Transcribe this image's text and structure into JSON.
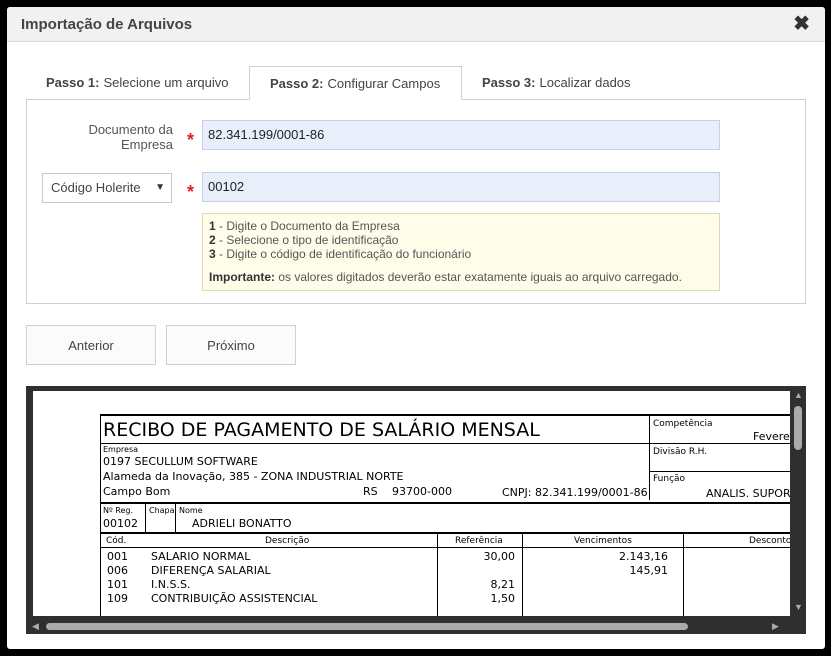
{
  "dialog": {
    "title": "Importação de Arquivos",
    "close_glyph": "✖"
  },
  "tabs": [
    {
      "step": "Passo 1:",
      "label": "Selecione um arquivo"
    },
    {
      "step": "Passo 2:",
      "label": "Configurar Campos"
    },
    {
      "step": "Passo 3:",
      "label": "Localizar dados"
    }
  ],
  "form": {
    "doc_label_line1": "Documento da",
    "doc_label_line2": "Empresa",
    "doc_value": "82.341.199/0001-86",
    "id_type_selected": "Código Holerite",
    "id_value": "00102",
    "required_mark": "*"
  },
  "hint": {
    "n1": "1",
    "t1": " - Digite o Documento da Empresa",
    "n2": "2",
    "t2": " - Selecione o tipo de identificação",
    "n3": "3",
    "t3": " - Digite o código de identificação do funcionário",
    "important_label": "Importante:",
    "important_text": " os valores digitados deverão estar exatamente iguais ao arquivo carregado."
  },
  "buttons": {
    "prev": "Anterior",
    "next": "Próximo"
  },
  "receipt": {
    "title": "RECIBO DE PAGAMENTO DE SALÁRIO MENSAL",
    "competencia_label": "Competência",
    "competencia_value": "Feverei",
    "empresa_label": "Empresa",
    "empresa_name": "0197 SECULLUM SOFTWARE",
    "address": "Alameda da Inovação, 385 - ZONA INDUSTRIAL NORTE",
    "city": "Campo Bom",
    "state": "RS",
    "zip": "93700-000",
    "cnpj": "CNPJ: 82.341.199/0001-86",
    "divisao_label": "Divisão R.H.",
    "funcao_label": "Função",
    "funcao_value": "ANALIS. SUPOR",
    "nreg_label": "Nº Reg.",
    "nreg_value": "00102",
    "chapa_label": "Chapa",
    "nome_label": "Nome",
    "nome_value": "ADRIELI BONATTO",
    "col_cod": "Cód.",
    "col_desc": "Descrição",
    "col_ref": "Referência",
    "col_venc": "Vencimentos",
    "col_desc2": "Descontos",
    "items": [
      {
        "cod": "001",
        "desc": "SALARIO NORMAL",
        "ref": "30,00",
        "venc": "2.143,16"
      },
      {
        "cod": "006",
        "desc": "DIFERENÇA SALARIAL",
        "ref": "",
        "venc": "145,91"
      },
      {
        "cod": "101",
        "desc": "I.N.S.S.",
        "ref": "8,21",
        "venc": ""
      },
      {
        "cod": "109",
        "desc": "CONTRIBUIÇÃO ASSISTENCIAL",
        "ref": "1,50",
        "venc": ""
      }
    ]
  }
}
